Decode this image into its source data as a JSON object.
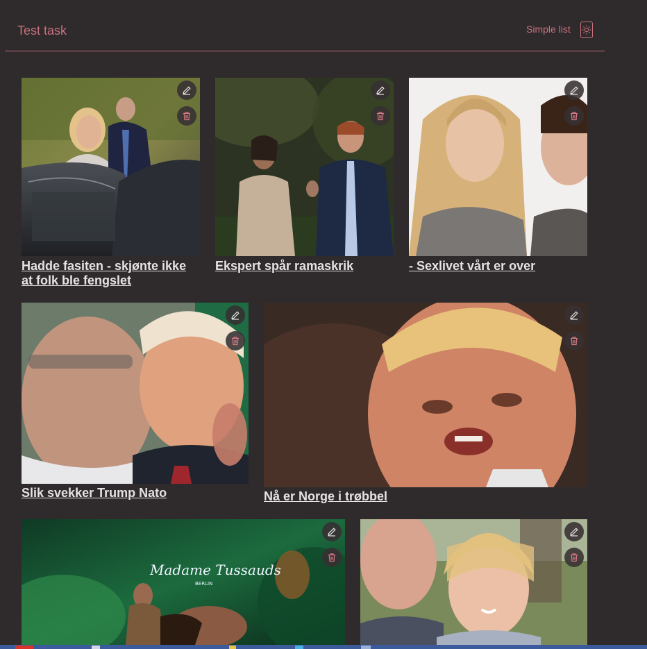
{
  "header": {
    "title": "Test task",
    "view_toggle_label": "Simple list",
    "theme_icon": "sun-icon"
  },
  "colors": {
    "background": "#2f2b2c",
    "accent": "#c8707d",
    "caption": "#e6e1e2"
  },
  "articles": [
    {
      "caption": "Hadde fasiten - skjønte ikke at folk ble fengslet",
      "edit_icon": "pencil-icon",
      "delete_icon": "trash-icon"
    },
    {
      "caption": "Ekspert spår ramaskrik",
      "edit_icon": "pencil-icon",
      "delete_icon": "trash-icon"
    },
    {
      "caption": "- Sexlivet vårt er over",
      "edit_icon": "pencil-icon",
      "delete_icon": "trash-icon"
    },
    {
      "caption": "Slik svekker Trump Nato",
      "edit_icon": "pencil-icon",
      "delete_icon": "trash-icon"
    },
    {
      "caption": "Nå er Norge i trøbbel",
      "edit_icon": "pencil-icon",
      "delete_icon": "trash-icon"
    },
    {
      "caption": "",
      "edit_icon": "pencil-icon",
      "delete_icon": "trash-icon"
    },
    {
      "caption": "",
      "edit_icon": "pencil-icon",
      "delete_icon": "trash-icon"
    }
  ]
}
